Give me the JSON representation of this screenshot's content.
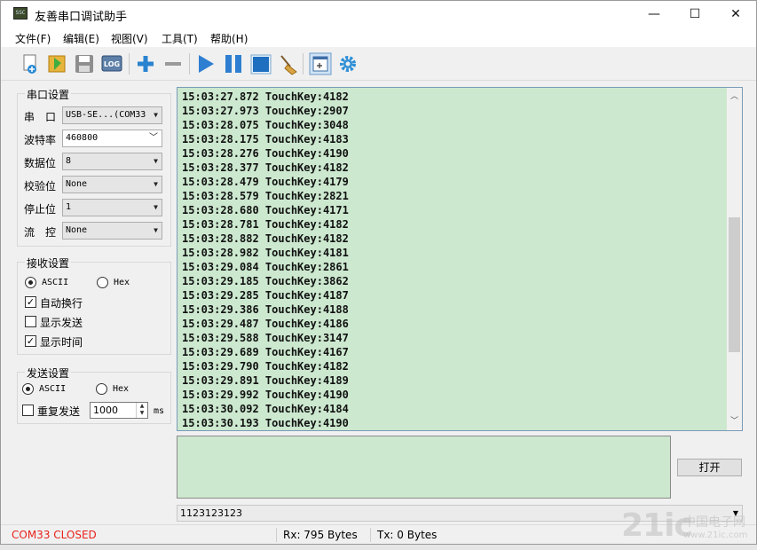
{
  "window": {
    "title": "友善串口调试助手",
    "app_icon": "app-icon",
    "minimize": "—",
    "maximize": "☐",
    "close": "✕"
  },
  "menu": [
    "文件(F)",
    "编辑(E)",
    "视图(V)",
    "工具(T)",
    "帮助(H)"
  ],
  "toolbar": {
    "icons": [
      "new-icon",
      "open-icon",
      "save-icon",
      "log-icon",
      "add-icon",
      "remove-icon",
      "play-icon",
      "pause-icon",
      "stop-icon",
      "clear-broom-icon",
      "window-icon",
      "settings-gear-icon"
    ],
    "log_label": "LOG"
  },
  "serial_settings": {
    "title": "串口设置",
    "port_label": "串　口",
    "port_value": "USB-SE...(COM33",
    "baud_label": "波特率",
    "baud_value": "460800",
    "databits_label": "数据位",
    "databits_value": "8",
    "parity_label": "校验位",
    "parity_value": "None",
    "stopbits_label": "停止位",
    "stopbits_value": "1",
    "flow_label": "流　控",
    "flow_value": "None"
  },
  "receive_settings": {
    "title": "接收设置",
    "ascii": "ASCII",
    "hex": "Hex",
    "auto_newline": "自动换行",
    "show_send": "显示发送",
    "show_time": "显示时间"
  },
  "send_settings": {
    "title": "发送设置",
    "ascii": "ASCII",
    "hex": "Hex",
    "repeat": "重复发送",
    "interval": "1000",
    "unit": "ms"
  },
  "receive_lines": [
    "15:03:27.872 TouchKey:4182",
    "15:03:27.973 TouchKey:2907",
    "15:03:28.075 TouchKey:3048",
    "15:03:28.175 TouchKey:4183",
    "15:03:28.276 TouchKey:4190",
    "15:03:28.377 TouchKey:4182",
    "15:03:28.479 TouchKey:4179",
    "15:03:28.579 TouchKey:2821",
    "15:03:28.680 TouchKey:4171",
    "15:03:28.781 TouchKey:4182",
    "15:03:28.882 TouchKey:4182",
    "15:03:28.982 TouchKey:4181",
    "15:03:29.084 TouchKey:2861",
    "15:03:29.185 TouchKey:3862",
    "15:03:29.285 TouchKey:4187",
    "15:03:29.386 TouchKey:4188",
    "15:03:29.487 TouchKey:4186",
    "15:03:29.588 TouchKey:3147",
    "15:03:29.689 TouchKey:4167",
    "15:03:29.790 TouchKey:4182",
    "15:03:29.891 TouchKey:4189",
    "15:03:29.992 TouchKey:4190",
    "15:03:30.092 TouchKey:4184",
    "15:03:30.193 TouchKey:4190"
  ],
  "open_button": "打开",
  "send_history": "1123123123",
  "status": {
    "port": "COM33 CLOSED",
    "rx": "Rx: 795 Bytes",
    "tx": "Tx: 0 Bytes"
  },
  "watermark": {
    "logo": "21ic",
    "site": "中国电子网",
    "url": "www.21ic.com"
  },
  "colors": {
    "receive_bg": "#cce8cf",
    "status_closed": "#e8221c"
  }
}
